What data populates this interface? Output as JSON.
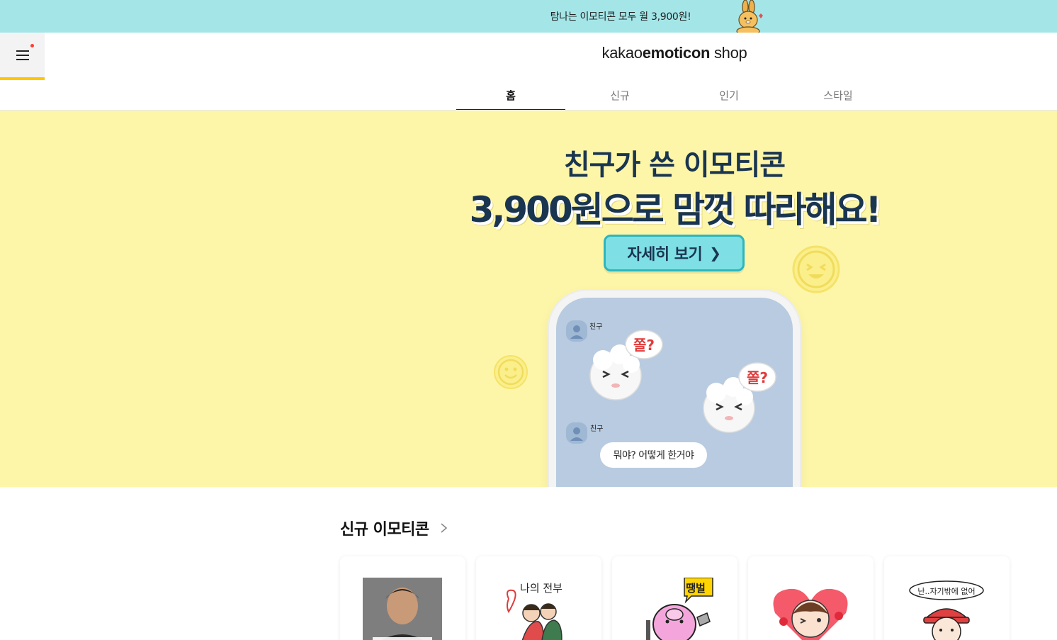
{
  "promo": {
    "text": "탐나는 이모티콘 모두 월 3,900원!"
  },
  "header": {
    "logo_regular": "kakao",
    "logo_bold": "emoticon",
    "logo_suffix": " shop",
    "tabs": [
      {
        "label": "홈",
        "active": true
      },
      {
        "label": "신규",
        "active": false
      },
      {
        "label": "인기",
        "active": false
      },
      {
        "label": "스타일",
        "active": false
      }
    ]
  },
  "hero": {
    "line1": "친구가 쓴 이모티콘",
    "line2": "3,900원으로 맘껏 따라해요!",
    "button_label": "자세히 보기",
    "chat": {
      "friend_label_1": "친구",
      "friend_label_2": "친구",
      "sticker_text_1": "쫄?",
      "sticker_text_2": "쫄?",
      "message": "뭐야? 어떻게 한거야"
    },
    "colors": {
      "background": "#fdf6a9",
      "button": "#7ee0e4",
      "text": "#1a3550"
    }
  },
  "new_section": {
    "title": "신규 이모티콘",
    "cards": [
      {
        "thumb_text": "",
        "icon": "man-photo-thumbnail"
      },
      {
        "thumb_text": "나의 전부",
        "icon": "couple-thumbnail"
      },
      {
        "thumb_text": "땡벌",
        "icon": "pink-bug-thumbnail"
      },
      {
        "thumb_text": "",
        "icon": "girl-heart-thumbnail"
      },
      {
        "thumb_text": "난..자기밖에 없어",
        "icon": "girl-red-hat-thumbnail"
      }
    ]
  }
}
